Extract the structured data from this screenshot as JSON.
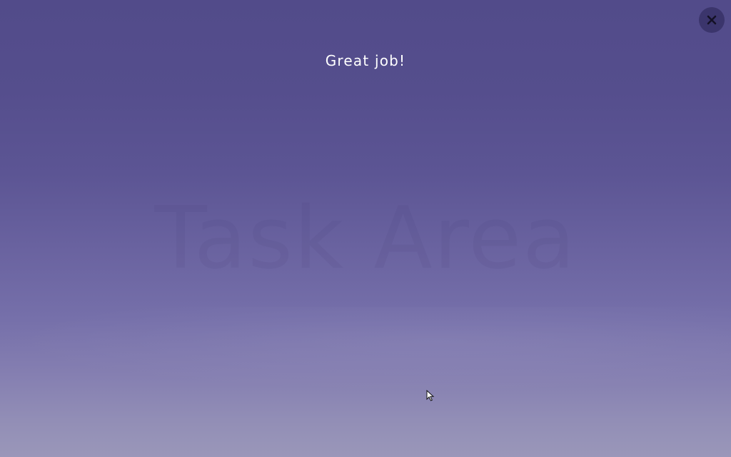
{
  "screen": {
    "message": "Great job!",
    "watermark": "Task Area"
  },
  "controls": {
    "close_icon": "close-icon"
  },
  "colors": {
    "background_top": "#524b8a",
    "background_bottom": "#9a97b9",
    "message_text": "#ffffff",
    "close_button_bg": "#2a2656"
  }
}
